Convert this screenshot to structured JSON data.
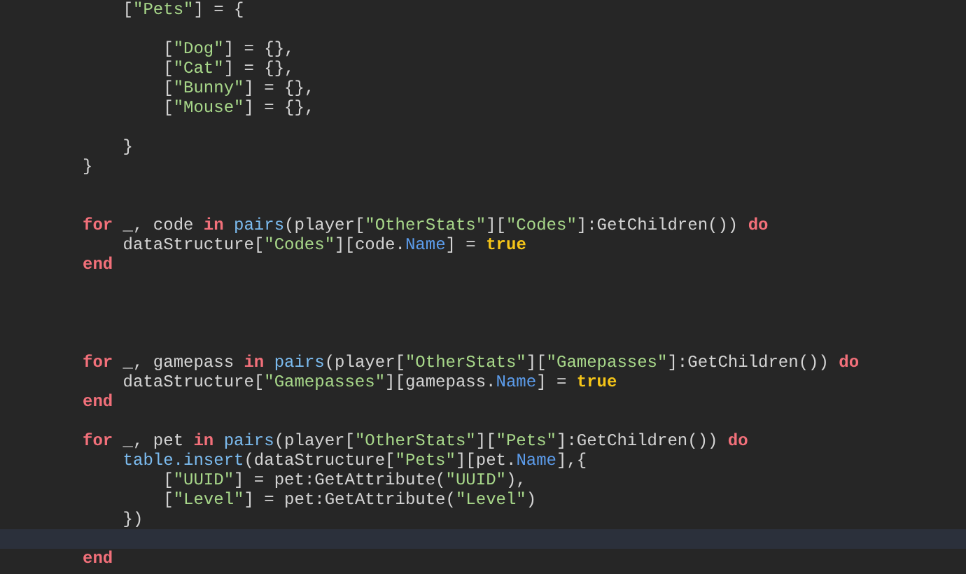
{
  "editor": {
    "lines": [
      {
        "kind": "code",
        "tokens": [
          {
            "kind": "plain",
            "text": "    ["
          },
          {
            "kind": "string",
            "text": "\"Pets\""
          },
          {
            "kind": "plain",
            "text": "] = {"
          }
        ]
      },
      {
        "kind": "blank"
      },
      {
        "kind": "code",
        "tokens": [
          {
            "kind": "plain",
            "text": "        ["
          },
          {
            "kind": "string",
            "text": "\"Dog\""
          },
          {
            "kind": "plain",
            "text": "] = {},"
          }
        ]
      },
      {
        "kind": "code",
        "tokens": [
          {
            "kind": "plain",
            "text": "        ["
          },
          {
            "kind": "string",
            "text": "\"Cat\""
          },
          {
            "kind": "plain",
            "text": "] = {},"
          }
        ]
      },
      {
        "kind": "code",
        "tokens": [
          {
            "kind": "plain",
            "text": "        ["
          },
          {
            "kind": "string",
            "text": "\"Bunny\""
          },
          {
            "kind": "plain",
            "text": "] = {},"
          }
        ]
      },
      {
        "kind": "code",
        "tokens": [
          {
            "kind": "plain",
            "text": "        ["
          },
          {
            "kind": "string",
            "text": "\"Mouse\""
          },
          {
            "kind": "plain",
            "text": "] = {},"
          }
        ]
      },
      {
        "kind": "blank"
      },
      {
        "kind": "code",
        "tokens": [
          {
            "kind": "plain",
            "text": "    }"
          }
        ]
      },
      {
        "kind": "code",
        "tokens": [
          {
            "kind": "plain",
            "text": "}"
          }
        ]
      },
      {
        "kind": "blank"
      },
      {
        "kind": "blank"
      },
      {
        "kind": "code",
        "tokens": [
          {
            "kind": "keyword",
            "text": "for"
          },
          {
            "kind": "plain",
            "text": " _, code "
          },
          {
            "kind": "keyword",
            "text": "in"
          },
          {
            "kind": "builtin",
            "text": " pairs"
          },
          {
            "kind": "plain",
            "text": "(player["
          },
          {
            "kind": "string",
            "text": "\"OtherStats\""
          },
          {
            "kind": "plain",
            "text": "]["
          },
          {
            "kind": "string",
            "text": "\"Codes\""
          },
          {
            "kind": "plain",
            "text": "]:GetChildren()) "
          },
          {
            "kind": "keyword",
            "text": "do"
          }
        ]
      },
      {
        "kind": "code",
        "tokens": [
          {
            "kind": "plain",
            "text": "    dataStructure["
          },
          {
            "kind": "string",
            "text": "\"Codes\""
          },
          {
            "kind": "plain",
            "text": "][code."
          },
          {
            "kind": "property",
            "text": "Name"
          },
          {
            "kind": "plain",
            "text": "] = "
          },
          {
            "kind": "bool",
            "text": "true"
          }
        ]
      },
      {
        "kind": "code",
        "tokens": [
          {
            "kind": "keyword",
            "text": "end"
          }
        ]
      },
      {
        "kind": "blank"
      },
      {
        "kind": "blank"
      },
      {
        "kind": "blank"
      },
      {
        "kind": "blank"
      },
      {
        "kind": "code",
        "tokens": [
          {
            "kind": "keyword",
            "text": "for"
          },
          {
            "kind": "plain",
            "text": " _, gamepass "
          },
          {
            "kind": "keyword",
            "text": "in"
          },
          {
            "kind": "builtin",
            "text": " pairs"
          },
          {
            "kind": "plain",
            "text": "(player["
          },
          {
            "kind": "string",
            "text": "\"OtherStats\""
          },
          {
            "kind": "plain",
            "text": "]["
          },
          {
            "kind": "string",
            "text": "\"Gamepasses\""
          },
          {
            "kind": "plain",
            "text": "]:GetChildren()) "
          },
          {
            "kind": "keyword",
            "text": "do"
          }
        ]
      },
      {
        "kind": "code",
        "tokens": [
          {
            "kind": "plain",
            "text": "    dataStructure["
          },
          {
            "kind": "string",
            "text": "\"Gamepasses\""
          },
          {
            "kind": "plain",
            "text": "][gamepass."
          },
          {
            "kind": "property",
            "text": "Name"
          },
          {
            "kind": "plain",
            "text": "] = "
          },
          {
            "kind": "bool",
            "text": "true"
          }
        ]
      },
      {
        "kind": "code",
        "tokens": [
          {
            "kind": "keyword",
            "text": "end"
          }
        ]
      },
      {
        "kind": "blank"
      },
      {
        "kind": "code",
        "tokens": [
          {
            "kind": "keyword",
            "text": "for"
          },
          {
            "kind": "plain",
            "text": " _, pet "
          },
          {
            "kind": "keyword",
            "text": "in"
          },
          {
            "kind": "builtin",
            "text": " pairs"
          },
          {
            "kind": "plain",
            "text": "(player["
          },
          {
            "kind": "string",
            "text": "\"OtherStats\""
          },
          {
            "kind": "plain",
            "text": "]["
          },
          {
            "kind": "string",
            "text": "\"Pets\""
          },
          {
            "kind": "plain",
            "text": "]:GetChildren()) "
          },
          {
            "kind": "keyword",
            "text": "do"
          }
        ]
      },
      {
        "kind": "code",
        "tokens": [
          {
            "kind": "builtin",
            "text": "    table.insert"
          },
          {
            "kind": "plain",
            "text": "(dataStructure["
          },
          {
            "kind": "string",
            "text": "\"Pets\""
          },
          {
            "kind": "plain",
            "text": "][pet."
          },
          {
            "kind": "property",
            "text": "Name"
          },
          {
            "kind": "plain",
            "text": "],{"
          }
        ]
      },
      {
        "kind": "code",
        "tokens": [
          {
            "kind": "plain",
            "text": "        ["
          },
          {
            "kind": "string",
            "text": "\"UUID\""
          },
          {
            "kind": "plain",
            "text": "] = pet:GetAttribute("
          },
          {
            "kind": "string",
            "text": "\"UUID\""
          },
          {
            "kind": "plain",
            "text": "),"
          }
        ]
      },
      {
        "kind": "code",
        "tokens": [
          {
            "kind": "plain",
            "text": "        ["
          },
          {
            "kind": "string",
            "text": "\"Level\""
          },
          {
            "kind": "plain",
            "text": "] = pet:GetAttribute("
          },
          {
            "kind": "string",
            "text": "\"Level\""
          },
          {
            "kind": "plain",
            "text": ")"
          }
        ]
      },
      {
        "kind": "code",
        "tokens": [
          {
            "kind": "plain",
            "text": "    })"
          }
        ]
      },
      {
        "kind": "current"
      },
      {
        "kind": "code",
        "tokens": [
          {
            "kind": "keyword",
            "text": "end"
          }
        ]
      }
    ]
  }
}
